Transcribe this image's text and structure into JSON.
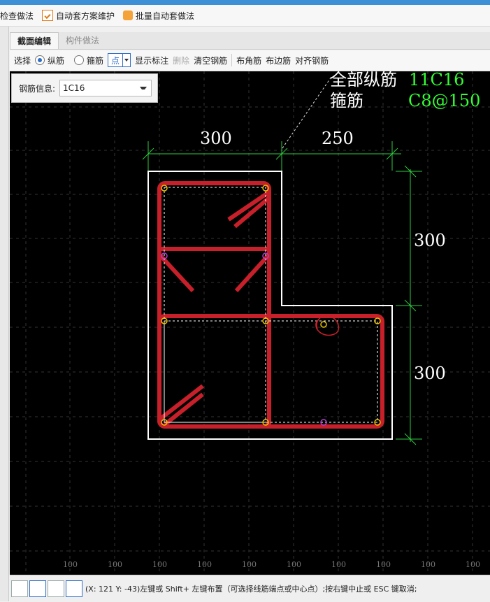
{
  "toolbar": {
    "items": [
      "检查做法",
      "自动套方案维护",
      "批量自动套做法"
    ]
  },
  "tabs": [
    "截面编辑",
    "构件做法"
  ],
  "editbar": {
    "select": "选择",
    "long_rebar": "纵筋",
    "stirrup": "箍筋",
    "point_mode": "点",
    "show_label": "显示标注",
    "delete": "删除",
    "clear": "清空钢筋",
    "corner": "布角筋",
    "edge": "布边筋",
    "align": "对齐钢筋"
  },
  "rebar_info": {
    "label": "钢筋信息:",
    "value": "1C16"
  },
  "annotation": {
    "long_label": "全部纵筋",
    "long_value": "11C16",
    "stirrup_label": "箍筋",
    "stirrup_value": "C8@150"
  },
  "dimensions": {
    "top_left": "300",
    "top_right": "250",
    "right_upper": "300",
    "right_lower": "300"
  },
  "grid_labels": {
    "bottom": [
      "100",
      "100",
      "100",
      "100",
      "100",
      "100",
      "100",
      "100",
      "100",
      "100"
    ]
  },
  "status": {
    "text": "(X: 121 Y: -43)左键或 Shift+ 左键布置（可选择线筋端点或中心点）;按右键中止或 ESC 键取消;"
  },
  "colors": {
    "rebar": "#c8202a",
    "dimension": "#2ecc40",
    "annotation_value": "#33ff33",
    "outline": "#ffffff",
    "accent": "#2f6fc7"
  }
}
